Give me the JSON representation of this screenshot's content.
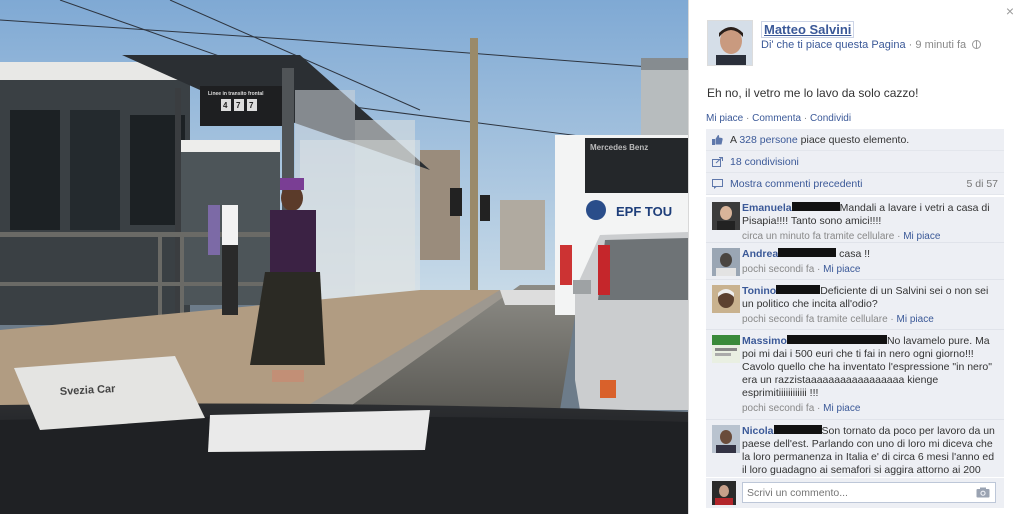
{
  "photo": {
    "shelter_sign_top": "Linee in transito frontal",
    "shelter_sign_digits": [
      "4",
      "7",
      "7"
    ],
    "bus_sign": "Mercedes Benz",
    "bus_logo": "EPF TOU",
    "dash_card": "Svezia Car"
  },
  "panel": {
    "close_label": "×",
    "author": {
      "name": "Matteo Salvini",
      "like_page": "Di' che ti piace questa Pagina",
      "separator": "·",
      "time": "9 minuti fa"
    },
    "post_text": "Eh no, il vetro me lo lavo da solo cazzo!",
    "actions": {
      "like": "Mi piace",
      "comment": "Commenta",
      "share": "Condividi",
      "sep": " · "
    },
    "likes": {
      "prefix": "A ",
      "link": "328 persone",
      "suffix": " piace questo elemento."
    },
    "shares": "18 condivisioni",
    "previous": {
      "label": "Mostra commenti precedenti",
      "count": "5 di 57"
    },
    "comments": [
      {
        "name": "Emanuela",
        "text": "Mandali a lavare i vetri a casa di Pisapia!!!! Tanto sono amici!!!!",
        "time": "circa un minuto fa tramite cellulare",
        "like": "Mi piace"
      },
      {
        "name": "Andrea",
        "text": "casa !!",
        "time": "pochi secondi fa",
        "like": "Mi piace"
      },
      {
        "name": "Tonino",
        "text": "Deficiente di un Salvini sei o non sei un politico che incita all'odio?",
        "time": "pochi secondi fa tramite cellulare",
        "like": "Mi piace"
      },
      {
        "name": "Massimo",
        "text": "No lavamelo pure. Ma poi mi dai i 500 euri che ti fai in nero ogni giorno!!! Cavolo quello che ha inventato l'espressione \"in nero\" era un razzistaaaaaaaaaaaaaaaaa kienge esprimitiiiiiiiiiiii !!!",
        "time": "pochi secondi fa",
        "like": "Mi piace"
      },
      {
        "name": "Nicola",
        "text": "Son tornato da poco per lavoro da un paese dell'est. Parlando con uno di loro mi diceva che la loro permanenza in Italia e' di circa 6 mesi l'anno ed il loro guadagno ai semafori si aggira attorno ai 200",
        "time": "",
        "like": ""
      }
    ],
    "reply_placeholder": "Scrivi un commento..."
  }
}
